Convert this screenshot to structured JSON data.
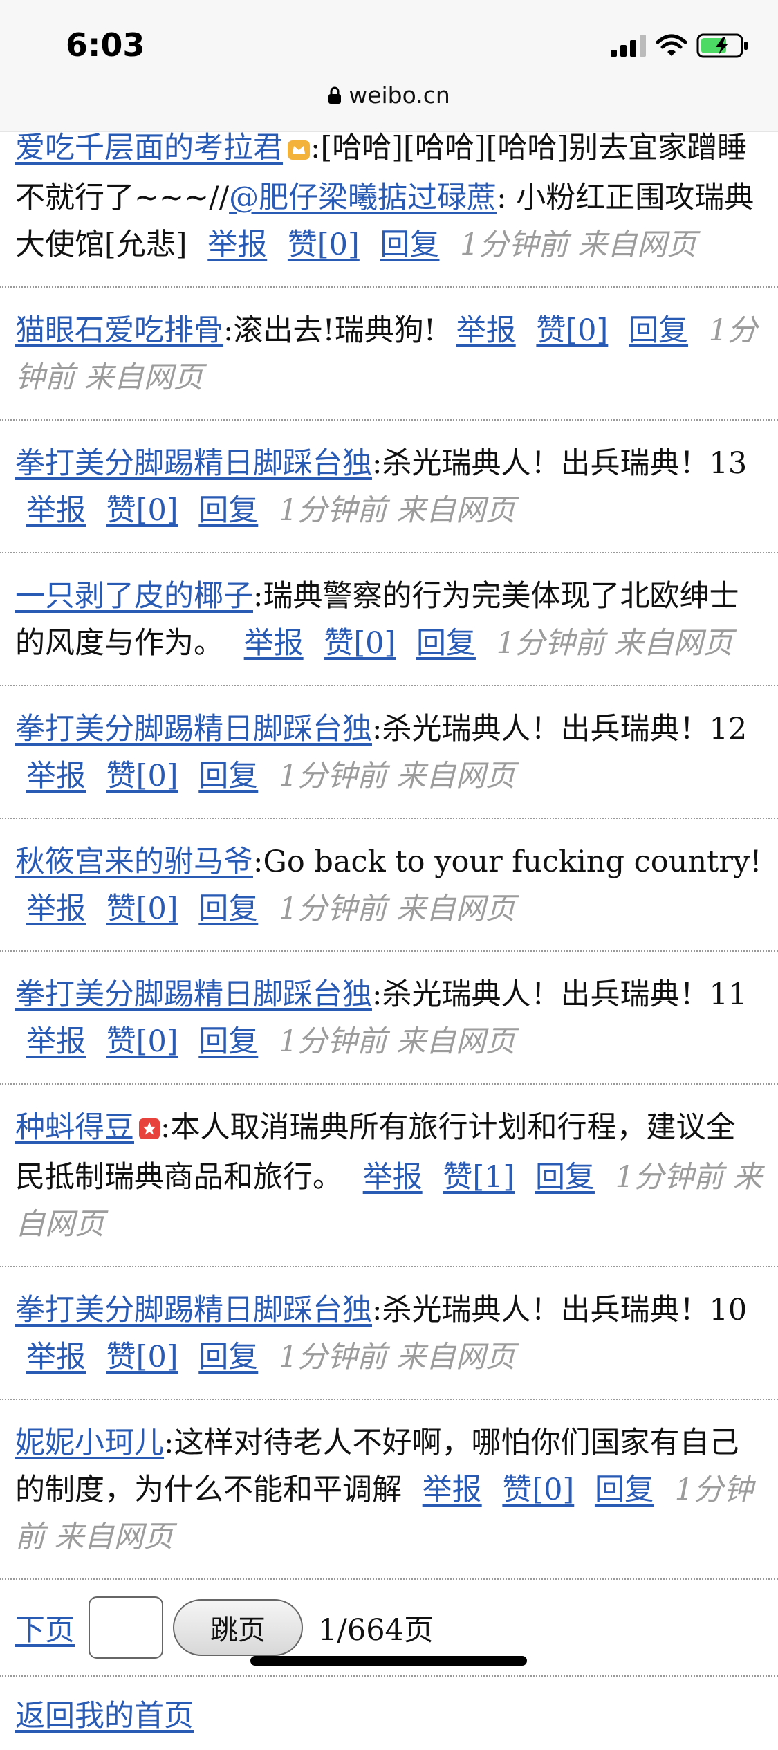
{
  "status": {
    "time": "6:03"
  },
  "url": {
    "text": "weibo.cn"
  },
  "comments": [
    {
      "user": "爱吃千层面的考拉君",
      "text": ":[哈哈][哈哈][哈哈]别去宜家蹭睡不就行了~~~//",
      "mention": "@肥仔梁曦掂过碌蔗",
      "text2": ": 小粉红正围攻瑞典大使馆[允悲]",
      "report": "举报",
      "like": "赞[0]",
      "reply": "回复",
      "meta": "1分钟前 来自网页"
    },
    {
      "user": "猫眼石爱吃排骨",
      "text": ":滚出去!瑞典狗!",
      "report": "举报",
      "like": "赞[0]",
      "reply": "回复",
      "meta": "1分钟前 来自网页"
    },
    {
      "user": "拳打美分脚踢精日脚踩台独",
      "text": ":杀光瑞典人！出兵瑞典！13",
      "report": "举报",
      "like": "赞[0]",
      "reply": "回复",
      "meta": "1分钟前 来自网页"
    },
    {
      "user": "一只剥了皮的椰子",
      "text": ":瑞典警察的行为完美体现了北欧绅士的风度与作为。",
      "report": "举报",
      "like": "赞[0]",
      "reply": "回复",
      "meta": "1分钟前 来自网页"
    },
    {
      "user": "拳打美分脚踢精日脚踩台独",
      "text": ":杀光瑞典人！出兵瑞典！12",
      "report": "举报",
      "like": "赞[0]",
      "reply": "回复",
      "meta": "1分钟前 来自网页"
    },
    {
      "user": "秋筱宫来的驸马爷",
      "text": ":Go back to your fucking country!",
      "report": "举报",
      "like": "赞[0]",
      "reply": "回复",
      "meta": "1分钟前 来自网页"
    },
    {
      "user": "拳打美分脚踢精日脚踩台独",
      "text": ":杀光瑞典人！出兵瑞典！11",
      "report": "举报",
      "like": "赞[0]",
      "reply": "回复",
      "meta": "1分钟前 来自网页"
    },
    {
      "user": "种蚪得豆",
      "text": ":本人取消瑞典所有旅行计划和行程，建议全民抵制瑞典商品和旅行。",
      "report": "举报",
      "like": "赞[1]",
      "reply": "回复",
      "meta": "1分钟前 来自网页"
    },
    {
      "user": "拳打美分脚踢精日脚踩台独",
      "text": ":杀光瑞典人！出兵瑞典！10",
      "report": "举报",
      "like": "赞[0]",
      "reply": "回复",
      "meta": "1分钟前 来自网页"
    },
    {
      "user": "妮妮小珂儿",
      "text": ":这样对待老人不好啊，哪怕你们国家有自己的制度，为什么不能和平调解",
      "report": "举报",
      "like": "赞[0]",
      "reply": "回复",
      "meta": "1分钟前 来自网页"
    }
  ],
  "pager": {
    "next": "下页",
    "jump": "跳页",
    "info": "1/664页"
  },
  "footer": {
    "home": "返回我的首页"
  }
}
